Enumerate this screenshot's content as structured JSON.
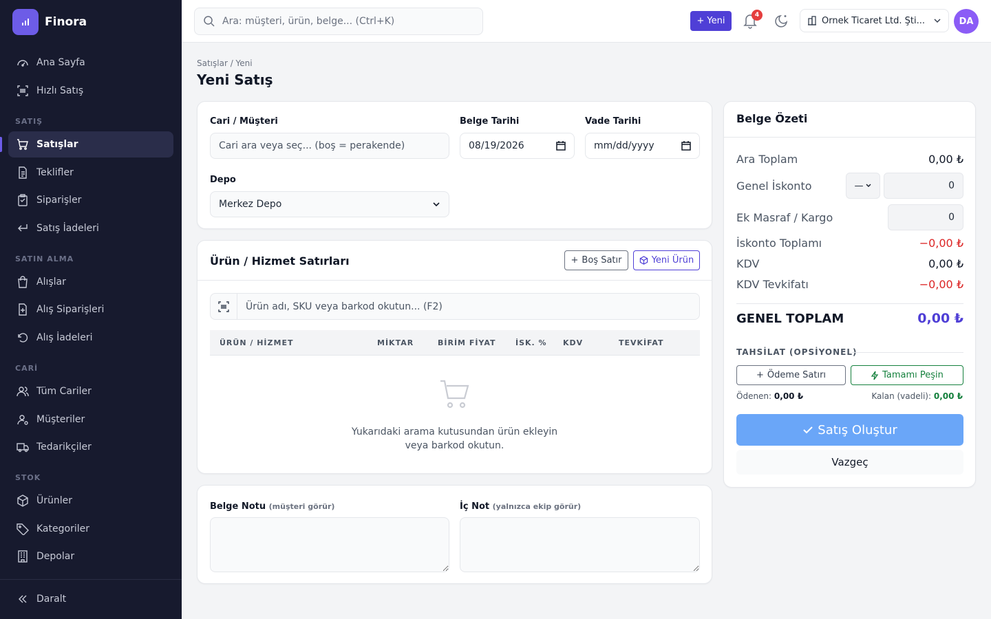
{
  "app": {
    "name": "Finora"
  },
  "sidebar": {
    "items": [
      {
        "label": "Ana Sayfa"
      },
      {
        "label": "Hızlı Satış"
      },
      {
        "label": "Satışlar"
      },
      {
        "label": "Teklifler"
      },
      {
        "label": "Siparişler"
      },
      {
        "label": "Satış İadeleri"
      },
      {
        "label": "Alışlar"
      },
      {
        "label": "Alış Siparişleri"
      },
      {
        "label": "Alış İadeleri"
      },
      {
        "label": "Tüm Cariler"
      },
      {
        "label": "Müşteriler"
      },
      {
        "label": "Tedarikçiler"
      },
      {
        "label": "Ürünler"
      },
      {
        "label": "Kategoriler"
      },
      {
        "label": "Depolar"
      }
    ],
    "sections": [
      "SATIŞ",
      "SATIN ALMA",
      "CARİ",
      "STOK"
    ],
    "collapse_label": "Daralt"
  },
  "topbar": {
    "search_placeholder": "Ara: müşteri, ürün, belge...  (Ctrl+K)",
    "new_label": "Yeni",
    "notification_count": "4",
    "company_name": "Örnek Ticaret Ltd. Şti...",
    "avatar_initials": "DA"
  },
  "page": {
    "breadcrumb": "Satışlar / Yeni",
    "title": "Yeni Satış"
  },
  "form": {
    "customer_label": "Cari / Müşteri",
    "customer_placeholder": "Cari ara veya seç... (boş = perakende)",
    "doc_date_label": "Belge Tarihi",
    "doc_date_value": "08/19/2026",
    "due_date_label": "Vade Tarihi",
    "due_date_value": "mm/dd/yyyy",
    "warehouse_label": "Depo",
    "warehouse_value": "Merkez Depo"
  },
  "lines": {
    "title": "Ürün / Hizmet Satırları",
    "empty_row_label": "Boş Satır",
    "new_product_label": "Yeni Ürün",
    "search_placeholder": "Ürün adı, SKU veya barkod okutun... (F2)",
    "columns": [
      "ÜRÜN / HİZMET",
      "MİKTAR",
      "BİRİM FİYAT",
      "İSK. %",
      "KDV",
      "TEVKİFAT"
    ],
    "empty_line1": "Yukarıdaki arama kutusundan ürün ekleyin",
    "empty_line2": "veya barkod okutun."
  },
  "notes": {
    "doc_note_label": "Belge Notu",
    "doc_note_hint": "(müşteri görür)",
    "internal_note_label": "İç Not",
    "internal_note_hint": "(yalnızca ekip görür)"
  },
  "summary": {
    "title": "Belge Özeti",
    "subtotal_label": "Ara Toplam",
    "subtotal_value": "0,00 ₺",
    "discount_label": "Genel İskonto",
    "discount_type": "—",
    "discount_value": "0",
    "extra_label": "Ek Masraf / Kargo",
    "extra_value": "0",
    "discount_total_label": "İskonto Toplamı",
    "discount_total_value": "−0,00 ₺",
    "vat_label": "KDV",
    "vat_value": "0,00 ₺",
    "withholding_label": "KDV Tevkifatı",
    "withholding_value": "−0,00 ₺",
    "grand_total_label": "GENEL TOPLAM",
    "grand_total_value": "0,00 ₺",
    "payment_section_label": "TAHSİLAT (OPSİYONEL)",
    "payment_row_label": "Ödeme Satırı",
    "full_cash_label": "Tamamı Peşin",
    "paid_label": "Ödenen:",
    "paid_value": "0,00 ₺",
    "remaining_label": "Kalan (vadeli):",
    "remaining_value": "0,00 ₺",
    "create_label": "Satış Oluştur",
    "cancel_label": "Vazgeç"
  },
  "colors": {
    "sidebar_bg": "#171a2e",
    "accent": "#4f3fd6",
    "brand": "#6d5ce7",
    "primary_button": "#6aa6f8",
    "danger": "#dc2626",
    "success": "#15803d"
  }
}
